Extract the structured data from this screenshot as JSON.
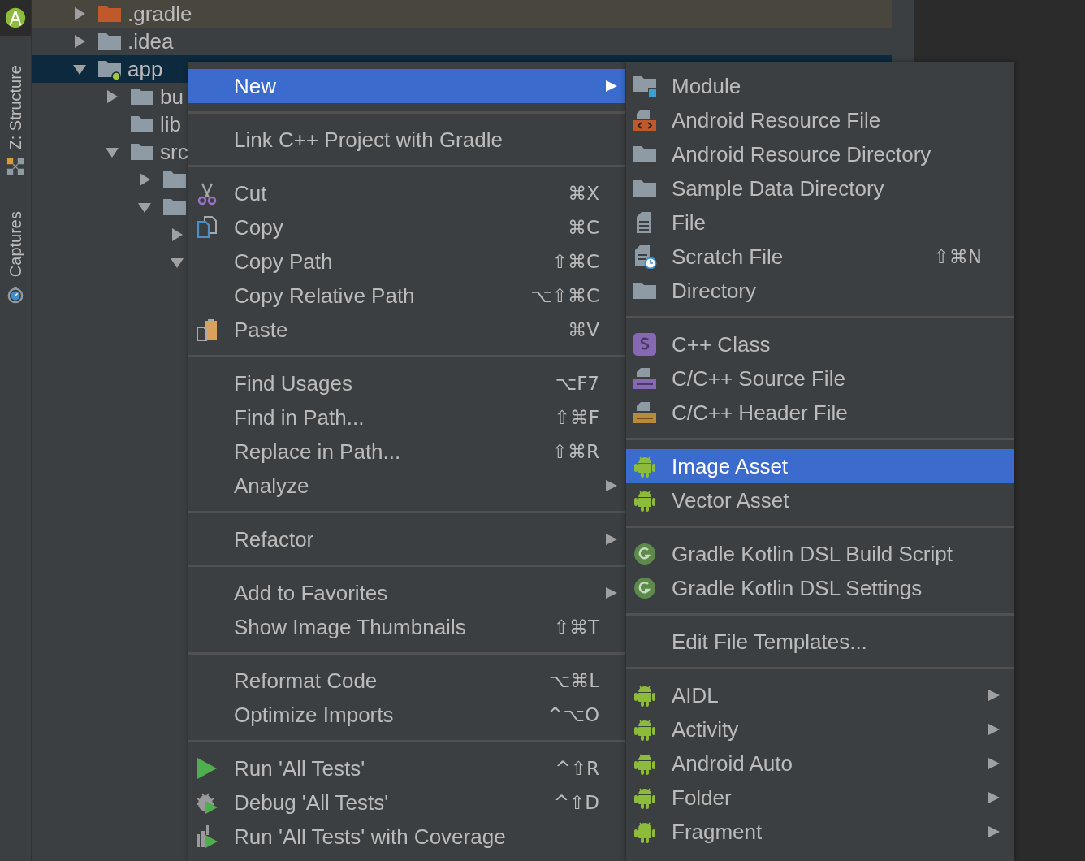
{
  "tool_strip": {
    "tabs": [
      {
        "label": "Z: Structure"
      },
      {
        "label": "Captures"
      }
    ]
  },
  "tree": [
    {
      "label": ".gradle",
      "kind": "excluded",
      "has_children": true,
      "expanded": false,
      "selected": false
    },
    {
      "label": ".idea",
      "kind": "folder",
      "has_children": true,
      "expanded": false,
      "selected": false
    },
    {
      "label": "app",
      "kind": "module",
      "has_children": true,
      "expanded": true,
      "selected": true,
      "children": [
        {
          "label": "bu",
          "kind": "folder",
          "has_children": true,
          "expanded": false,
          "selected": false
        },
        {
          "label": "lib",
          "kind": "folder",
          "has_children": false,
          "selected": false
        },
        {
          "label": "src",
          "kind": "folder",
          "has_children": true,
          "expanded": true,
          "selected": false,
          "children": [
            {
              "kind": "folder",
              "has_children": true,
              "expanded": false,
              "selected": false
            },
            {
              "kind": "folder",
              "has_children": true,
              "expanded": true,
              "selected": false,
              "children": [
                {
                  "has_children": true,
                  "expanded": false,
                  "selected": false
                },
                {
                  "has_children": true,
                  "expanded": true,
                  "selected": false
                }
              ]
            }
          ]
        }
      ]
    }
  ],
  "context_menu": {
    "groups": [
      [
        {
          "label": "New",
          "submenu": true,
          "selected": true
        }
      ],
      [
        {
          "label": "Link C++ Project with Gradle",
          "submenu": false,
          "selected": false
        }
      ],
      [
        {
          "label": "Cut",
          "shortcut": "⌘X",
          "submenu": false,
          "selected": false
        },
        {
          "label": "Copy",
          "shortcut": "⌘C",
          "submenu": false,
          "selected": false
        },
        {
          "label": "Copy Path",
          "shortcut": "⇧⌘C",
          "submenu": false,
          "selected": false
        },
        {
          "label": "Copy Relative Path",
          "shortcut": "⌥⇧⌘C",
          "submenu": false,
          "selected": false
        },
        {
          "label": "Paste",
          "shortcut": "⌘V",
          "submenu": false,
          "selected": false
        }
      ],
      [
        {
          "label": "Find Usages",
          "shortcut": "⌥F7",
          "submenu": false,
          "selected": false
        },
        {
          "label": "Find in Path...",
          "shortcut": "⇧⌘F",
          "submenu": false,
          "selected": false
        },
        {
          "label": "Replace in Path...",
          "shortcut": "⇧⌘R",
          "submenu": false,
          "selected": false
        },
        {
          "label": "Analyze",
          "submenu": true,
          "selected": false
        }
      ],
      [
        {
          "label": "Refactor",
          "submenu": true,
          "selected": false
        }
      ],
      [
        {
          "label": "Add to Favorites",
          "submenu": true,
          "selected": false
        },
        {
          "label": "Show Image Thumbnails",
          "shortcut": "⇧⌘T",
          "submenu": false,
          "selected": false
        }
      ],
      [
        {
          "label": "Reformat Code",
          "shortcut": "⌥⌘L",
          "submenu": false,
          "selected": false
        },
        {
          "label": "Optimize Imports",
          "shortcut": "^⌥O",
          "submenu": false,
          "selected": false
        }
      ],
      [
        {
          "label": "Run 'All Tests'",
          "shortcut": "^⇧R",
          "submenu": false,
          "selected": false
        },
        {
          "label": "Debug 'All Tests'",
          "shortcut": "^⇧D",
          "submenu": false,
          "selected": false
        },
        {
          "label": "Run 'All Tests' with Coverage",
          "submenu": false,
          "selected": false
        }
      ]
    ]
  },
  "new_submenu": {
    "groups": [
      [
        {
          "label": "Module",
          "submenu": false,
          "selected": false
        },
        {
          "label": "Android Resource File",
          "submenu": false,
          "selected": false
        },
        {
          "label": "Android Resource Directory",
          "submenu": false,
          "selected": false
        },
        {
          "label": "Sample Data Directory",
          "submenu": false,
          "selected": false
        },
        {
          "label": "File",
          "submenu": false,
          "selected": false
        },
        {
          "label": "Scratch File",
          "shortcut": "⇧⌘N",
          "submenu": false,
          "selected": false
        },
        {
          "label": "Directory",
          "submenu": false,
          "selected": false
        }
      ],
      [
        {
          "label": "C++ Class",
          "submenu": false,
          "selected": false
        },
        {
          "label": "C/C++ Source File",
          "submenu": false,
          "selected": false
        },
        {
          "label": "C/C++ Header File",
          "submenu": false,
          "selected": false
        }
      ],
      [
        {
          "label": "Image Asset",
          "submenu": false,
          "selected": true
        },
        {
          "label": "Vector Asset",
          "submenu": false,
          "selected": false
        }
      ],
      [
        {
          "label": "Gradle Kotlin DSL Build Script",
          "submenu": false,
          "selected": false
        },
        {
          "label": "Gradle Kotlin DSL Settings",
          "submenu": false,
          "selected": false
        }
      ],
      [
        {
          "label": "Edit File Templates...",
          "submenu": false,
          "selected": false
        }
      ],
      [
        {
          "label": "AIDL",
          "submenu": true,
          "selected": false
        },
        {
          "label": "Activity",
          "submenu": true,
          "selected": false
        },
        {
          "label": "Android Auto",
          "submenu": true,
          "selected": false
        },
        {
          "label": "Folder",
          "submenu": true,
          "selected": false
        },
        {
          "label": "Fragment",
          "submenu": true,
          "selected": false
        }
      ]
    ]
  }
}
